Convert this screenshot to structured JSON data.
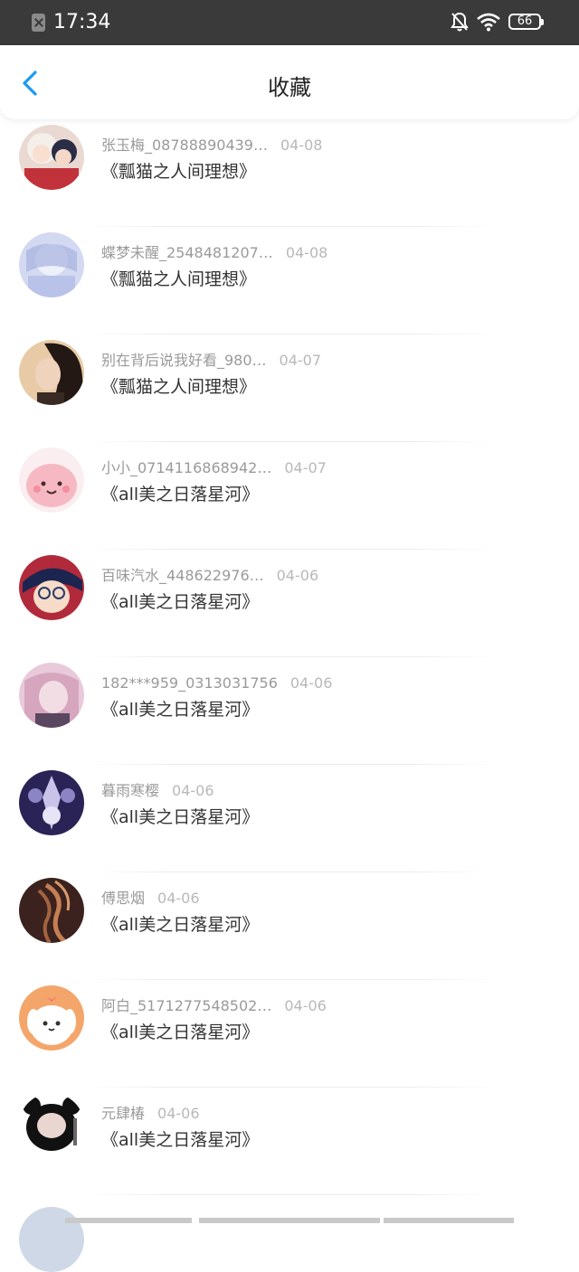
{
  "status_bar": {
    "time": "17:34",
    "battery": "66",
    "icons": [
      "notification-icon",
      "bell-muted-icon",
      "wifi-icon",
      "battery-icon"
    ]
  },
  "header": {
    "title": "收藏",
    "back_icon": "chevron-left-icon",
    "accent": "#1a9bf0"
  },
  "items": [
    {
      "user": "张玉梅_08788890439…",
      "date": "04-08",
      "title": "《瓢猫之人间理想》",
      "avatar_colors": [
        "#e8d6d0",
        "#c04040"
      ]
    },
    {
      "user": "蝶梦未醒_2548481207…",
      "date": "04-08",
      "title": "《瓢猫之人间理想》",
      "avatar_colors": [
        "#c9d3ee",
        "#8f9cd4"
      ]
    },
    {
      "user": "别在背后说我好看_980…",
      "date": "04-07",
      "title": "《瓢猫之人间理想》",
      "avatar_colors": [
        "#e6c9a3",
        "#2a1e1a"
      ]
    },
    {
      "user": "小小_0714116868942…",
      "date": "04-07",
      "title": "《all美之日落星河》",
      "avatar_colors": [
        "#f7e8e8",
        "#f2a8b4"
      ]
    },
    {
      "user": "百味汽水_448622976…",
      "date": "04-06",
      "title": "《all美之日落星河》",
      "avatar_colors": [
        "#b0223a",
        "#1a2a55"
      ]
    },
    {
      "user": "182***959_0313031756",
      "date": "04-06",
      "title": "《all美之日落星河》",
      "avatar_colors": [
        "#e6c3d4",
        "#b7859f"
      ]
    },
    {
      "user": "暮雨寒樱",
      "date": "04-06",
      "title": "《all美之日落星河》",
      "avatar_colors": [
        "#2d2558",
        "#c7c2e6"
      ]
    },
    {
      "user": "傅思烟",
      "date": "04-06",
      "title": "《all美之日落星河》",
      "avatar_colors": [
        "#3a2320",
        "#b9734a"
      ]
    },
    {
      "user": "阿白_5171277548502…",
      "date": "04-06",
      "title": "《all美之日落星河》",
      "avatar_colors": [
        "#f4a66a",
        "#ffffff"
      ]
    },
    {
      "user": "元肆椿",
      "date": "04-06",
      "title": "《all美之日落星河》",
      "avatar_colors": [
        "#ffffff",
        "#111111"
      ]
    }
  ]
}
